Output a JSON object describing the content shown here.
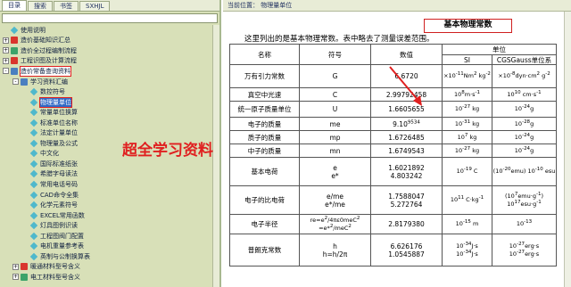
{
  "tabs": [
    "目录",
    "搜索",
    "书签",
    "SXHJL"
  ],
  "tree": [
    {
      "label": "使用说明",
      "icon": "page-icon",
      "expander": "",
      "indent": 0
    },
    {
      "label": "造价基础知识汇总",
      "icon": "book-icon",
      "expander": "+",
      "indent": 0
    },
    {
      "label": "造价全过程编制流程",
      "icon": "book-icon",
      "expander": "+",
      "indent": 0
    },
    {
      "label": "工程识图及计算流程",
      "icon": "book-icon",
      "expander": "+",
      "indent": 0
    },
    {
      "label": "造价常备查询资料",
      "icon": "book-open-icon",
      "expander": "-",
      "indent": 0,
      "highlight": true
    },
    {
      "label": "学习资料汇编",
      "icon": "book-open-icon",
      "expander": "-",
      "indent": 1
    },
    {
      "label": "数控符号",
      "icon": "page-icon",
      "expander": "",
      "indent": 2
    },
    {
      "label": "物理量单位",
      "icon": "page-icon",
      "expander": "",
      "indent": 2,
      "selected": true
    },
    {
      "label": "常量单位换算",
      "icon": "page-icon",
      "expander": "",
      "indent": 2
    },
    {
      "label": "标准单位名称",
      "icon": "page-icon",
      "expander": "",
      "indent": 2
    },
    {
      "label": "法定计量单位",
      "icon": "page-icon",
      "expander": "",
      "indent": 2
    },
    {
      "label": "物理量及公式",
      "icon": "page-icon",
      "expander": "",
      "indent": 2
    },
    {
      "label": "中文化",
      "icon": "page-icon",
      "expander": "",
      "indent": 2
    },
    {
      "label": "国际标准纸张",
      "icon": "page-icon",
      "expander": "",
      "indent": 2
    },
    {
      "label": "希腊字母读法",
      "icon": "page-icon",
      "expander": "",
      "indent": 2
    },
    {
      "label": "常用电话号码",
      "icon": "page-icon",
      "expander": "",
      "indent": 2
    },
    {
      "label": "CAD命令全集",
      "icon": "page-icon",
      "expander": "",
      "indent": 2
    },
    {
      "label": "化学元素符号",
      "icon": "page-icon",
      "expander": "",
      "indent": 2
    },
    {
      "label": "EXCEL常用函数",
      "icon": "page-icon",
      "expander": "",
      "indent": 2
    },
    {
      "label": "灯具图例识读",
      "icon": "page-icon",
      "expander": "",
      "indent": 2
    },
    {
      "label": "工程图阀门配置",
      "icon": "page-icon",
      "expander": "",
      "indent": 2
    },
    {
      "label": "电机重量参考表",
      "icon": "page-icon",
      "expander": "",
      "indent": 2
    },
    {
      "label": "英制与公制换算表",
      "icon": "page-icon",
      "expander": "",
      "indent": 2
    },
    {
      "label": "暖通材料型号含义",
      "icon": "book-icon",
      "expander": "+",
      "indent": 1
    },
    {
      "label": "电工材料型号含义",
      "icon": "book-icon",
      "expander": "+",
      "indent": 1
    }
  ],
  "location": "当前位置： 物理量单位",
  "doc_title": "基本物理常数",
  "intro": "这里列出的是基本物理常数。表中略去了测量误差范围。",
  "table": {
    "headers": {
      "name": "名称",
      "symbol": "符号",
      "value": "数值",
      "unit": "单位",
      "si": "SI",
      "cgs": "CGSGauss单位系"
    },
    "rows": [
      {
        "name": "万有引力常数",
        "symbol": "G",
        "value": "6.6720",
        "si": "×10-11Nm2 kg-2",
        "cgs": "×10-8dyn·cm2 g-2"
      },
      {
        "name": "真空中光速",
        "symbol": "C",
        "value": "2.99792458",
        "si": "108m·s-1",
        "cgs": "1010 cm·s-1"
      },
      {
        "name": "统一原子质量单位",
        "symbol": "U",
        "value": "1.6605655",
        "si": "10-27 kg",
        "cgs": "10-24g"
      },
      {
        "name": "电子的质量",
        "symbol": "me",
        "value": "9.109534",
        "si": "10-31 kg",
        "cgs": "10-28g"
      },
      {
        "name": "质子的质量",
        "symbol": "mp",
        "value": "1.6726485",
        "si": "107 kg",
        "cgs": "10-24g"
      },
      {
        "name": "中子的质量",
        "symbol": "mn",
        "value": "1.6749543",
        "si": "10-27 kg",
        "cgs": "10-24g"
      },
      {
        "name": "基本电荷",
        "symbol": "e / e*",
        "value": "1.6021892 / 4.803242",
        "si": "10-19 C",
        "cgs": "(10-20emu) 10-10 esu"
      },
      {
        "name": "电子的比电荷",
        "symbol": "e/me / e*/me",
        "value": "1.7588047 / 5.272764",
        "si": "1011 C·kg-1",
        "cgs": "(107emu·g-1) 1017esu·g-1"
      },
      {
        "name": "电子半径",
        "symbol": "re=e2/4πε0meC2 / =e*2/meC2",
        "value": "2.8179380",
        "si": "10-15 m",
        "cgs": "10-13"
      },
      {
        "name": "普朗克常数",
        "symbol": "h / h=h/2π",
        "value": "6.626176 / 1.0545887",
        "si": "10-34J·s / 10-34J·s",
        "cgs": "10-27erg·s / 10-27erg·s"
      }
    ]
  },
  "annotation": "超全学习资料"
}
